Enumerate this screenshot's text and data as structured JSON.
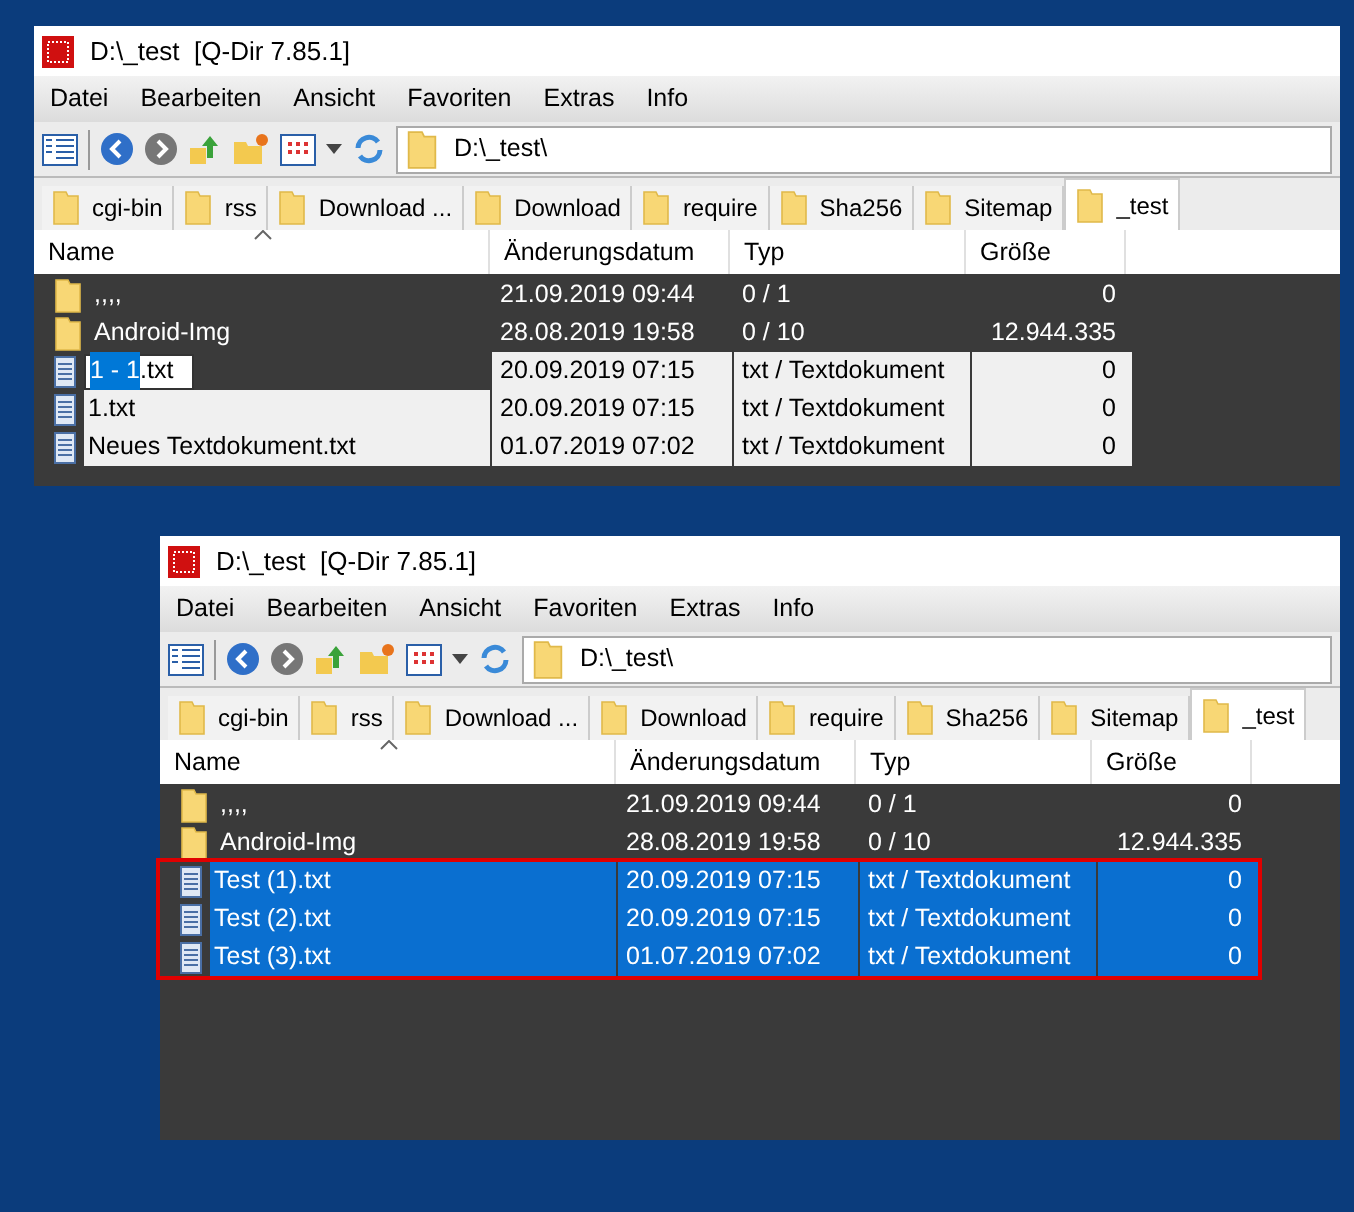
{
  "windows": [
    {
      "title": "D:\\_test  [Q-Dir 7.85.1]",
      "active": false,
      "highlight_selection": false,
      "menu": [
        "Datei",
        "Bearbeiten",
        "Ansicht",
        "Favoriten",
        "Extras",
        "Info"
      ],
      "address": "D:\\_test\\",
      "tabs": [
        {
          "label": "cgi-bin",
          "selected": false
        },
        {
          "label": "rss",
          "selected": false
        },
        {
          "label": "Download ...",
          "selected": false
        },
        {
          "label": "Download",
          "selected": false
        },
        {
          "label": "require",
          "selected": false
        },
        {
          "label": "Sha256",
          "selected": false
        },
        {
          "label": "Sitemap",
          "selected": false
        },
        {
          "label": "_test",
          "selected": true
        }
      ],
      "columns": [
        "Name",
        "Änderungsdatum",
        "Typ",
        "Größe"
      ],
      "rows": [
        {
          "kind": "folder",
          "name": ",,,,",
          "date": "21.09.2019 09:44",
          "type": "0 / 1",
          "size": "0",
          "selected": false
        },
        {
          "kind": "folder",
          "name": "Android-Img",
          "date": "28.08.2019 19:58",
          "type": "0 / 10",
          "size": "12.944.335",
          "selected": false
        },
        {
          "kind": "file",
          "name": ".txt",
          "rename_selection": "1 - 1",
          "date": "20.09.2019 07:15",
          "type": "txt / Textdokument",
          "size": "0",
          "selected": true
        },
        {
          "kind": "file",
          "name": "1.txt",
          "date": "20.09.2019 07:15",
          "type": "txt / Textdokument",
          "size": "0",
          "selected": true
        },
        {
          "kind": "file",
          "name": "Neues Textdokument.txt",
          "date": "01.07.2019 07:02",
          "type": "txt / Textdokument",
          "size": "0",
          "selected": true
        }
      ]
    },
    {
      "title": "D:\\_test  [Q-Dir 7.85.1]",
      "active": true,
      "highlight_selection": true,
      "menu": [
        "Datei",
        "Bearbeiten",
        "Ansicht",
        "Favoriten",
        "Extras",
        "Info"
      ],
      "address": "D:\\_test\\",
      "tabs": [
        {
          "label": "cgi-bin",
          "selected": false
        },
        {
          "label": "rss",
          "selected": false
        },
        {
          "label": "Download ...",
          "selected": false
        },
        {
          "label": "Download",
          "selected": false
        },
        {
          "label": "require",
          "selected": false
        },
        {
          "label": "Sha256",
          "selected": false
        },
        {
          "label": "Sitemap",
          "selected": false
        },
        {
          "label": "_test",
          "selected": true
        }
      ],
      "columns": [
        "Name",
        "Änderungsdatum",
        "Typ",
        "Größe"
      ],
      "rows": [
        {
          "kind": "folder",
          "name": ",,,,",
          "date": "21.09.2019 09:44",
          "type": "0 / 1",
          "size": "0",
          "selected": false
        },
        {
          "kind": "folder",
          "name": "Android-Img",
          "date": "28.08.2019 19:58",
          "type": "0 / 10",
          "size": "12.944.335",
          "selected": false
        },
        {
          "kind": "file",
          "name": "Test (1).txt",
          "date": "20.09.2019 07:15",
          "type": "txt / Textdokument",
          "size": "0",
          "selected": true
        },
        {
          "kind": "file",
          "name": "Test (2).txt",
          "date": "20.09.2019 07:15",
          "type": "txt / Textdokument",
          "size": "0",
          "selected": true
        },
        {
          "kind": "file",
          "name": "Test (3).txt",
          "date": "01.07.2019 07:02",
          "type": "txt / Textdokument",
          "size": "0",
          "selected": true
        }
      ]
    }
  ]
}
